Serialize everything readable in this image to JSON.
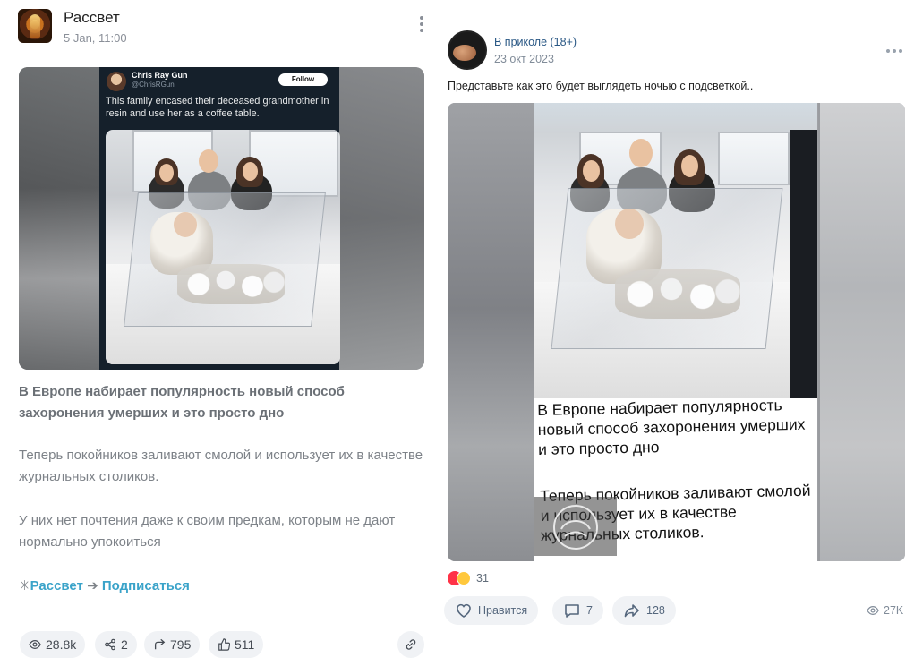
{
  "left_post": {
    "community_name": "Рассвет",
    "date": "5 Jan, 11:00",
    "tweet": {
      "author_name": "Chris Ray Gun",
      "author_handle": "@ChrisRGun",
      "follow_label": "Follow",
      "text": "This family encased their deceased grandmother in resin and use her as a coffee table."
    },
    "headline": "В Европе набирает популярность новый способ захоронения умерших и это просто дно",
    "paragraph_1": "Теперь покойников заливают смолой и использует их в качестве журнальных столиков.",
    "paragraph_2": "У них нет почтения даже к своим предкам, которым не дают нормально упокоиться",
    "star_glyph": "✳",
    "community_link": "Рассвет",
    "arrow_glyph": "➔",
    "subscribe_link": "Подписаться",
    "stats": {
      "views": "28.8k",
      "shares": "2",
      "reposts": "795",
      "likes": "511"
    },
    "icons": [
      "kebab-icon",
      "eye-icon",
      "share-icon",
      "repost-icon",
      "thumbs-up-icon",
      "link-icon"
    ]
  },
  "right_post": {
    "community_name": "В приколе (18+)",
    "date": "23 окт 2023",
    "text": "Представьте как это будет выглядеть ночью с подсветкой..",
    "image_caption_1": "В Европе набирает популярность новый способ захоронения умерших и это просто дно",
    "image_caption_2": "Теперь покойников заливают смолой и использует их в качестве журнальных столиков.",
    "reactions_count": "31",
    "like_label": "Нравится",
    "comments_count": "7",
    "shares_count": "128",
    "views": "27K",
    "icons": [
      "more-icon",
      "heart-icon",
      "comment-icon",
      "share-arrow-icon",
      "eye-icon"
    ]
  },
  "colors": {
    "link_blue": "#3aa3c9",
    "vk_blue": "#2a5885",
    "muted_text": "#7d8288",
    "pill_bg": "#f0f2f5"
  }
}
